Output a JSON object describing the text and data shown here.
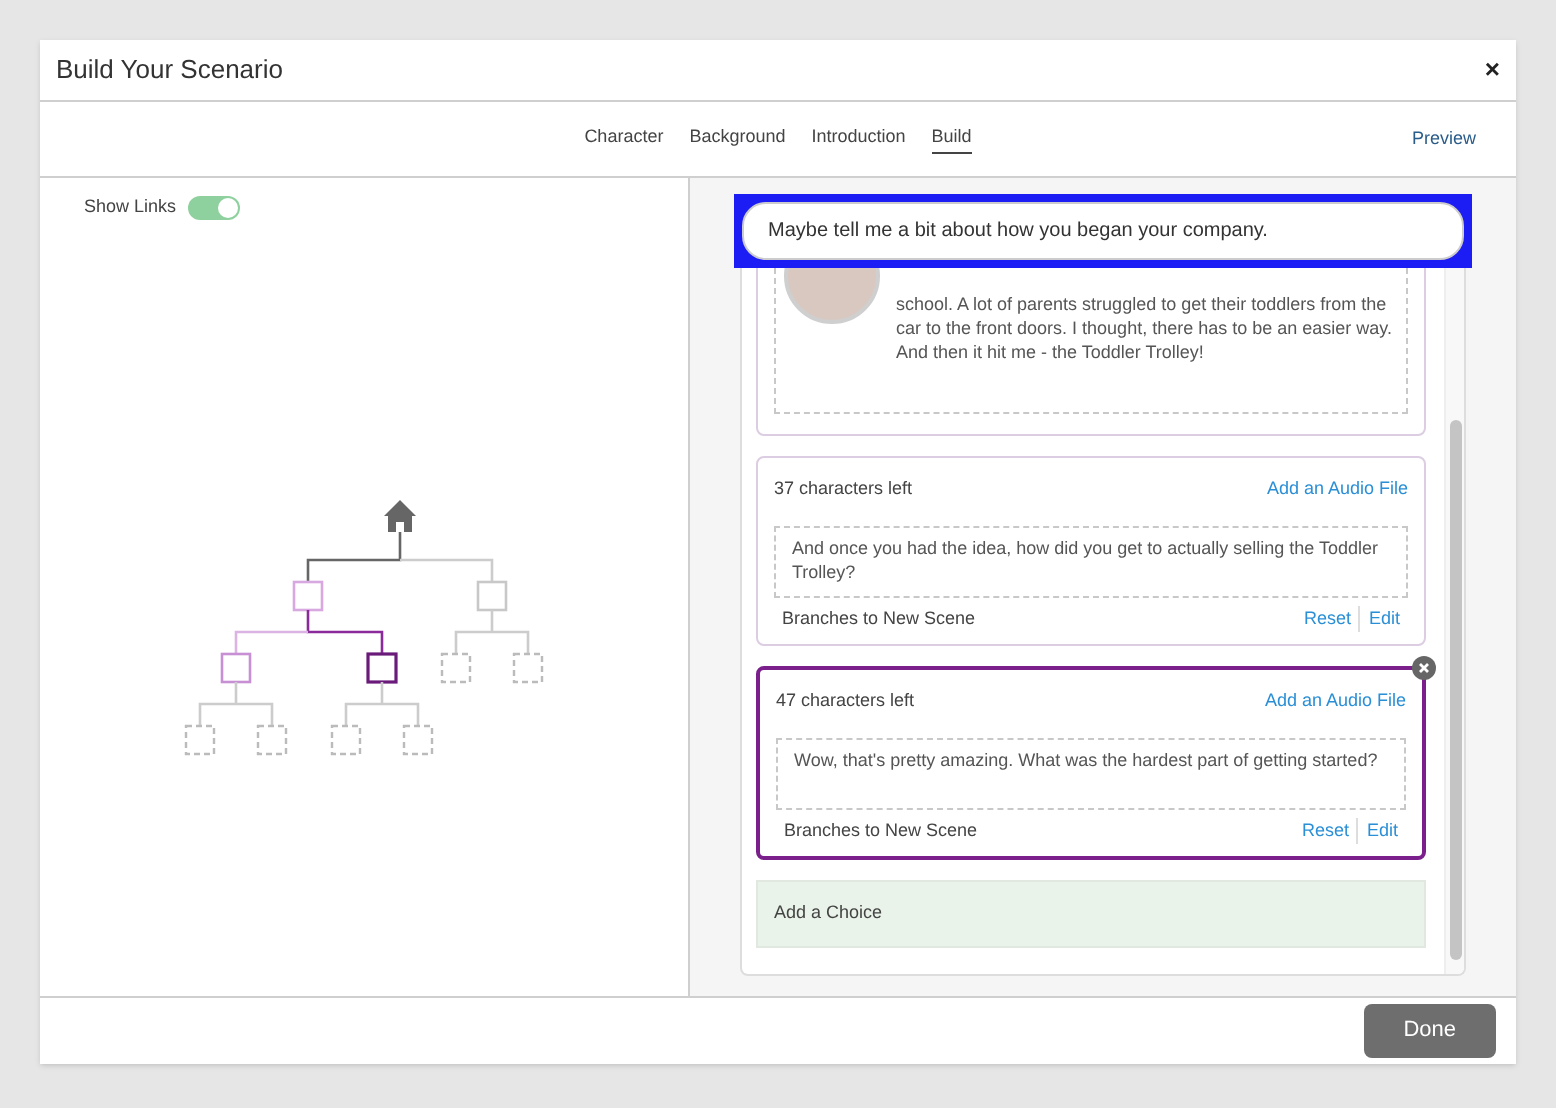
{
  "window": {
    "title": "Build Your Scenario",
    "close": "×"
  },
  "tabs": [
    {
      "label": "Character",
      "selected": false
    },
    {
      "label": "Background",
      "selected": false
    },
    {
      "label": "Introduction",
      "selected": false
    },
    {
      "label": "Build",
      "selected": true
    }
  ],
  "preview": "Preview",
  "show_links": {
    "label": "Show Links",
    "on": true
  },
  "prompt": {
    "text": "Maybe tell me a bit about how you began your company.",
    "highlighted": true
  },
  "cards": [
    {
      "kind": "scene",
      "text": "school. A lot of parents struggled to get their toddlers from the car to the front doors. I thought, there has to be an easier way. And then it hit me - the Toddler Trolley!",
      "selected": false
    },
    {
      "kind": "choice",
      "counter": "37 characters left",
      "audio_link": "Add an Audio File",
      "text": "And once you had the idea, how did you get to actually selling the Toddler Trolley?",
      "branch": "Branches to New Scene",
      "reset": "Reset",
      "edit": "Edit",
      "selected": false
    },
    {
      "kind": "choice",
      "counter": "47 characters left",
      "audio_link": "Add an Audio File",
      "text": "Wow, that's pretty amazing. What was the hardest part of getting started?",
      "branch": "Branches to New Scene",
      "reset": "Reset",
      "edit": "Edit",
      "selected": true
    }
  ],
  "add_choice": "Add a Choice",
  "done": "Done"
}
